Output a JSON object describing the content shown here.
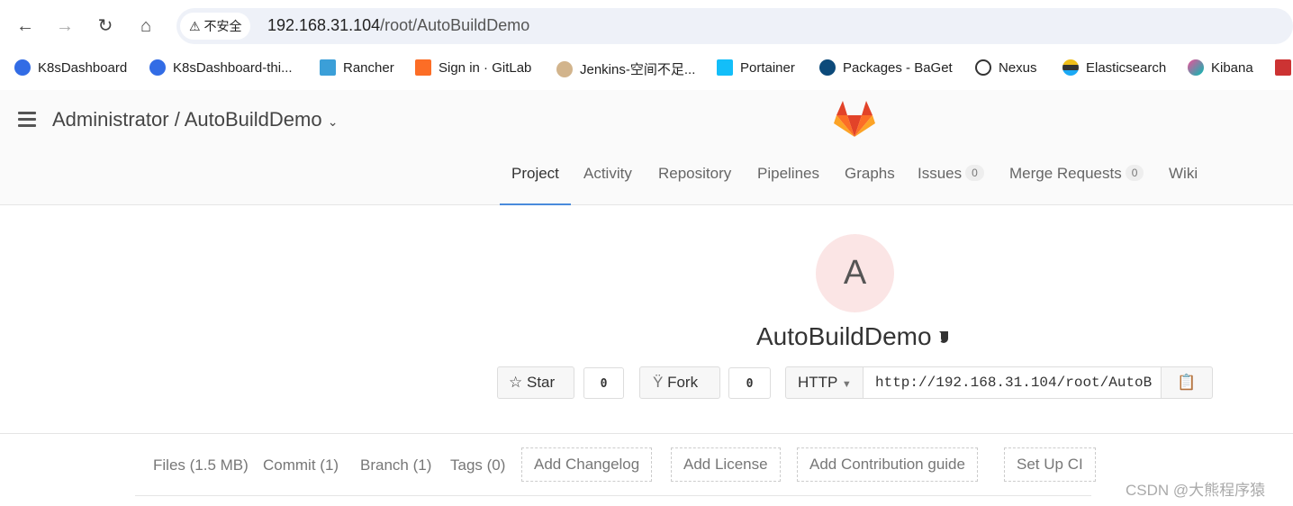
{
  "browser": {
    "security_label": "不安全",
    "url_host": "192.168.31.104",
    "url_path": "/root/AutoBuildDemo"
  },
  "bookmarks": [
    "K8sDashboard",
    "K8sDashboard-thi...",
    "Rancher",
    "Sign in · GitLab",
    "Jenkins-空间不足...",
    "Portainer",
    "Packages - BaGet",
    "Nexus",
    "Elasticsearch",
    "Kibana"
  ],
  "header": {
    "breadcrumb": "Administrator / AutoBuildDemo"
  },
  "tabs": [
    {
      "label": "Project"
    },
    {
      "label": "Activity"
    },
    {
      "label": "Repository"
    },
    {
      "label": "Pipelines"
    },
    {
      "label": "Graphs"
    },
    {
      "label": "Issues",
      "count": "0"
    },
    {
      "label": "Merge Requests",
      "count": "0"
    },
    {
      "label": "Wiki"
    }
  ],
  "project": {
    "avatar_letter": "A",
    "name": "AutoBuildDemo",
    "star_label": "Star",
    "star_count": "0",
    "fork_label": "Fork",
    "fork_count": "0",
    "protocol": "HTTP",
    "clone_url": "http://192.168.31.104/root/AutoB"
  },
  "stats": {
    "files": "Files (1.5 MB)",
    "commit": "Commit (1)",
    "branch": "Branch (1)",
    "tags": "Tags (0)",
    "add_changelog": "Add Changelog",
    "add_license": "Add License",
    "add_contribution": "Add Contribution guide",
    "setup_ci": "Set Up CI"
  },
  "watermark": "CSDN @大熊程序猿",
  "colors": {
    "accent": "#4a8bdc",
    "avatar_bg": "#fbe5e5"
  }
}
